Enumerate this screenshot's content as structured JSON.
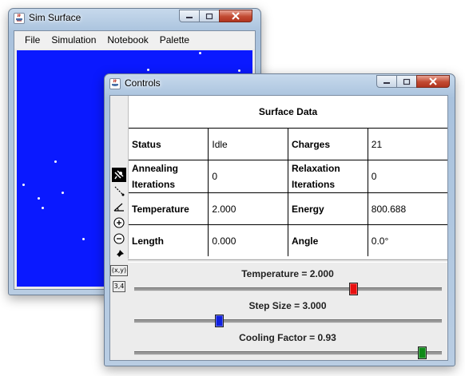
{
  "sim_window": {
    "title": "Sim Surface",
    "menu": [
      "File",
      "Simulation",
      "Notebook",
      "Palette"
    ],
    "surface_color": "#0a19ff",
    "charge_color": "#ffffff",
    "charges_visible": 11
  },
  "controls_window": {
    "title": "Controls",
    "tools": [
      "probe-icon",
      "line-icon",
      "angle-icon",
      "add-charge-icon",
      "remove-charge-icon",
      "pin-icon",
      "coordinates-icon",
      "label-3-4-icon"
    ],
    "coord_tool_text": "(x,y)",
    "label_tool_text": "3,4",
    "data_title": "Surface Data",
    "rows": [
      [
        {
          "k": "Status",
          "v": "Idle"
        },
        {
          "k": "Charges",
          "v": "21"
        }
      ],
      [
        {
          "k": "Annealing Iterations",
          "v": "0"
        },
        {
          "k": "Relaxation Iterations",
          "v": "0"
        }
      ],
      [
        {
          "k": "Temperature",
          "v": "2.000"
        },
        {
          "k": "Energy",
          "v": "800.688"
        }
      ],
      [
        {
          "k": "Length",
          "v": "0.000"
        },
        {
          "k": "Angle",
          "v": "0.0°"
        }
      ]
    ],
    "sliders": [
      {
        "label": "Temperature = 2.000",
        "fraction": 0.72,
        "thumb_color": "#e81010"
      },
      {
        "label": "Step Size = 3.000",
        "fraction": 0.27,
        "thumb_color": "#1020e0"
      },
      {
        "label": "Cooling Factor = 0.93",
        "fraction": 0.95,
        "thumb_color": "#0e8a18"
      }
    ]
  }
}
